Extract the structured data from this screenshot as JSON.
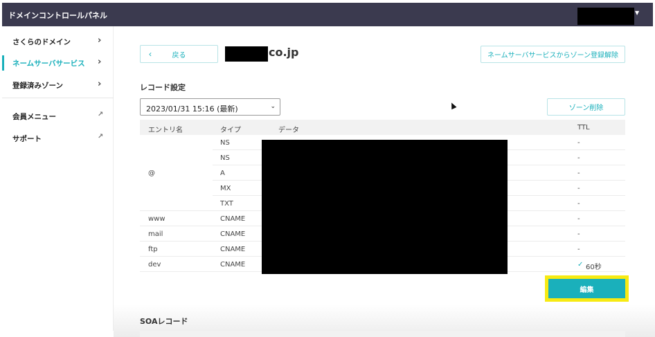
{
  "header": {
    "title": "ドメインコントロールパネル"
  },
  "sidebar": {
    "items": [
      {
        "label": "さくらのドメイン",
        "icon": "chevron-right-icon"
      },
      {
        "label": "ネームサーバサービス",
        "icon": "chevron-right-icon",
        "active": true
      },
      {
        "label": "登録済みゾーン",
        "icon": "chevron-right-icon"
      },
      {
        "label": "会員メニュー",
        "icon": "external-link-icon"
      },
      {
        "label": "サポート",
        "icon": "external-link-icon"
      }
    ]
  },
  "main": {
    "back_label": "戻る",
    "domain_suffix": "co.jp",
    "zone_unregister_label": "ネームサーバサービスからゾーン登録解除",
    "records_title": "レコード設定",
    "version_select": "2023/01/31 15:16 (最新)",
    "zone_delete_label": "ゾーン削除",
    "table": {
      "headers": [
        "エントリ名",
        "タイプ",
        "データ",
        "TTL"
      ],
      "rows": [
        {
          "entry": "",
          "type": "NS",
          "ttl": "-"
        },
        {
          "entry": "",
          "type": "NS",
          "ttl": "-"
        },
        {
          "entry": "@",
          "type": "A",
          "ttl": "-"
        },
        {
          "entry": "",
          "type": "MX",
          "ttl": "-"
        },
        {
          "entry": "",
          "type": "TXT",
          "ttl": "-"
        },
        {
          "entry": "www",
          "type": "CNAME",
          "ttl": "-"
        },
        {
          "entry": "mail",
          "type": "CNAME",
          "ttl": "-"
        },
        {
          "entry": "ftp",
          "type": "CNAME",
          "ttl": "-"
        },
        {
          "entry": "dev",
          "type": "CNAME",
          "ttl": "60秒",
          "ttl_check": "✓"
        }
      ]
    },
    "edit_label": "編集",
    "soa_title": "SOAレコード"
  },
  "colors": {
    "accent": "#1ab0bb",
    "topbar": "#3b3a4f",
    "highlight": "#f7ea12"
  }
}
